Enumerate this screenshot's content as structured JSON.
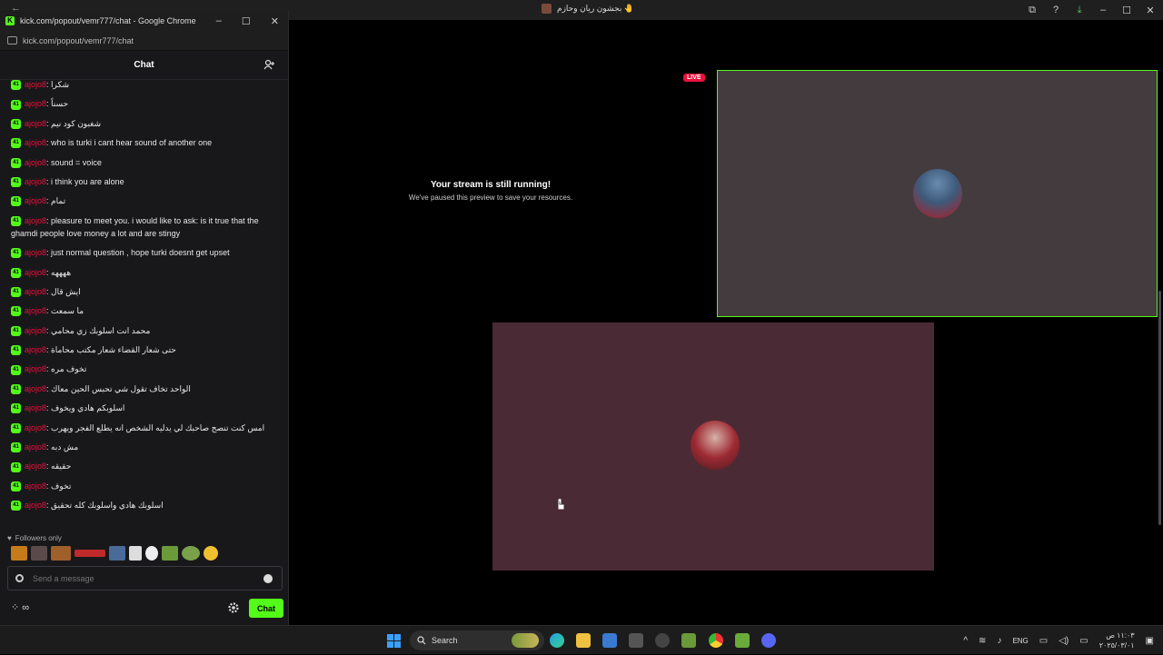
{
  "main_window": {
    "tab_title": "بجشون ريان وحازم 🤚",
    "controls": [
      "⧉",
      "?",
      "⤓",
      "–",
      "☐",
      "✕"
    ]
  },
  "popout": {
    "window_title": "kick.com/popout/vemr777/chat - Google Chrome",
    "url": "kick.com/popout/vemr777/chat",
    "chat_title": "Chat",
    "badge_label": "41",
    "messages": [
      {
        "user": "ajojo8",
        "text": ": شكرا"
      },
      {
        "user": "ajojo8",
        "text": ": حسناً"
      },
      {
        "user": "ajojo8",
        "text": ": شغبون كود نيم"
      },
      {
        "user": "ajojo8",
        "text": ": who is turki i cant hear sound of another one"
      },
      {
        "user": "ajojo8",
        "text": ": sound = voice"
      },
      {
        "user": "ajojo8",
        "text": ": i think you are alone"
      },
      {
        "user": "ajojo8",
        "text": ": تمام"
      },
      {
        "user": "ajojo8",
        "text": ": pleasure to meet you. i would like to ask: is it true that the ghamdi people love money a lot and are stingy"
      },
      {
        "user": "ajojo8",
        "text": ": just normal question , hope turki doesnt get upset"
      },
      {
        "user": "ajojo8",
        "text": ": ههههه"
      },
      {
        "user": "ajojo8",
        "text": ": ايش قال"
      },
      {
        "user": "ajojo8",
        "text": ": ما سمعت"
      },
      {
        "user": "ajojo8",
        "text": ": محمد انت اسلوبك زي محامي"
      },
      {
        "user": "ajojo8",
        "text": ": حتى شعار القضاء شعار مكتب محاماة"
      },
      {
        "user": "ajojo8",
        "text": ": تخوف مره"
      },
      {
        "user": "ajojo8",
        "text": ": الواحد تخاف تقول شي تحبس الحين معاك"
      },
      {
        "user": "ajojo8",
        "text": ": اسلوبكم هادي ويخوف"
      },
      {
        "user": "ajojo8",
        "text": ": امس كنت تنصح صاحبك لي يدليه الشخص انه يطلع الفجر ويهرب"
      },
      {
        "user": "ajojo8",
        "text": ": مش دبه"
      },
      {
        "user": "ajojo8",
        "text": ": حقيقه"
      },
      {
        "user": "ajojo8",
        "text": ": تخوف"
      },
      {
        "user": "ajojo8",
        "text": ": اسلوبك هادي واسلوبك كله تحقيق"
      }
    ],
    "followers_only": "Followers only",
    "input_placeholder": "Send a message",
    "chat_button": "Chat",
    "bottom_left_icons": "⁘ ∞"
  },
  "stream": {
    "paused_title": "Your stream is still running!",
    "paused_subtitle": "We've paused this preview to save your resources.",
    "live_label": "LIVE"
  },
  "taskbar": {
    "search_label": "Search",
    "language": "ENG",
    "time": "١١:٠٣ ص",
    "date": "٢٠٢٥/٠٣/٠١"
  }
}
